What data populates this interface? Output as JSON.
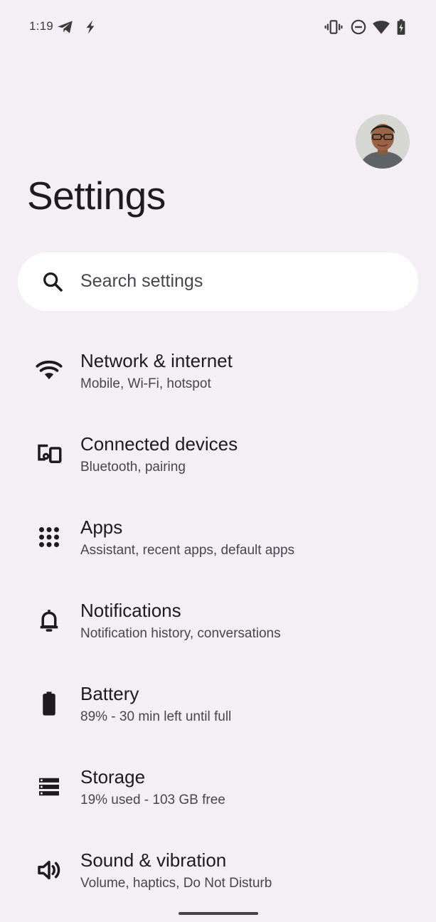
{
  "status_bar": {
    "time": "1:19",
    "left_icons": [
      "telegram-icon",
      "flash-icon"
    ],
    "right_icons": [
      "vibrate-icon",
      "do-not-disturb-icon",
      "wifi-icon",
      "battery-charging-icon"
    ]
  },
  "header": {
    "title": "Settings",
    "avatar": "profile-avatar"
  },
  "search": {
    "placeholder": "Search settings"
  },
  "items": [
    {
      "icon": "wifi-icon",
      "title": "Network & internet",
      "subtitle": "Mobile, Wi-Fi, hotspot"
    },
    {
      "icon": "devices-icon",
      "title": "Connected devices",
      "subtitle": "Bluetooth, pairing"
    },
    {
      "icon": "apps-grid-icon",
      "title": "Apps",
      "subtitle": "Assistant, recent apps, default apps"
    },
    {
      "icon": "bell-icon",
      "title": "Notifications",
      "subtitle": "Notification history, conversations"
    },
    {
      "icon": "battery-icon",
      "title": "Battery",
      "subtitle": "89% - 30 min left until full"
    },
    {
      "icon": "storage-icon",
      "title": "Storage",
      "subtitle": "19% used - 103 GB free"
    },
    {
      "icon": "volume-icon",
      "title": "Sound & vibration",
      "subtitle": "Volume, haptics, Do Not Disturb"
    }
  ],
  "colors": {
    "background": "#f4eff4",
    "surface": "#ffffff",
    "text_primary": "#1d1b20",
    "text_secondary": "#46464f"
  }
}
